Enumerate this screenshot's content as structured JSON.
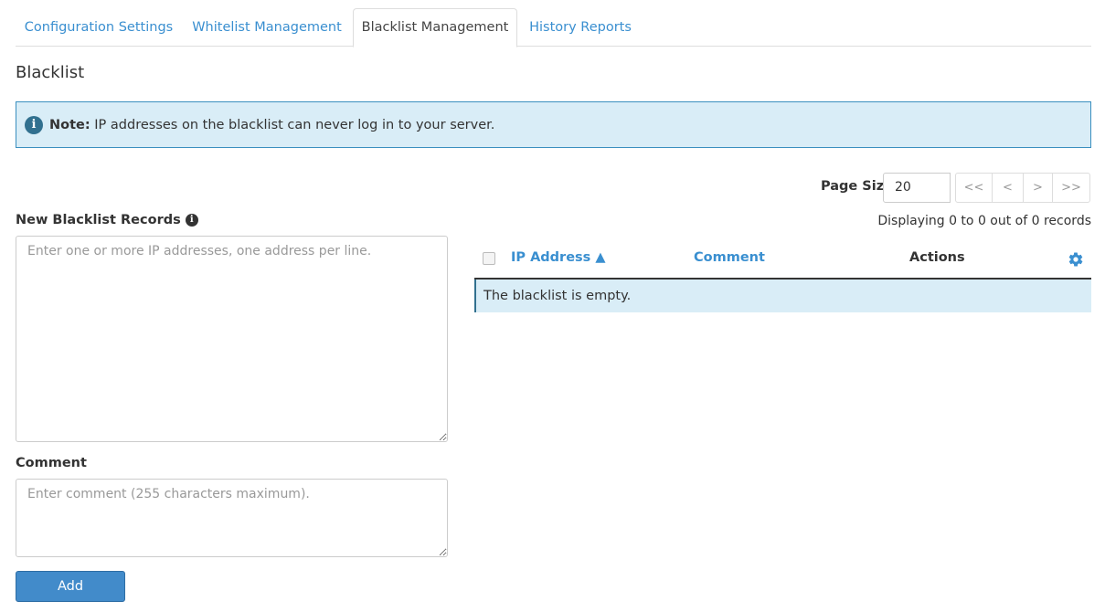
{
  "tabs": [
    {
      "label": "Configuration Settings",
      "active": false
    },
    {
      "label": "Whitelist Management",
      "active": false
    },
    {
      "label": "Blacklist Management",
      "active": true
    },
    {
      "label": "History Reports",
      "active": false
    }
  ],
  "page_title": "Blacklist",
  "note": {
    "icon": "info-circle-icon",
    "bold": "Note:",
    "text": " IP addresses on the blacklist can never log in to your server."
  },
  "form": {
    "records_label": "New Blacklist Records",
    "records_placeholder": "Enter one or more IP addresses, one address per line.",
    "comment_label": "Comment",
    "comment_placeholder": "Enter comment (255 characters maximum).",
    "add_label": "Add"
  },
  "pager": {
    "page_size_label": "Page Size",
    "page_size_value": "20",
    "first_label": "<<",
    "prev_label": "<",
    "next_label": ">",
    "last_label": ">>",
    "records_info": "Displaying 0 to 0 out of 0 records"
  },
  "table": {
    "columns": {
      "ip": "IP Address ▲",
      "comment": "Comment",
      "actions": "Actions"
    },
    "settings_icon": "gear-icon",
    "empty_message": "The blacklist is empty."
  },
  "colors": {
    "link": "#3a8fd0",
    "note_bg": "#d9edf7",
    "note_border": "#3a8fbf",
    "button": "#428bca"
  }
}
